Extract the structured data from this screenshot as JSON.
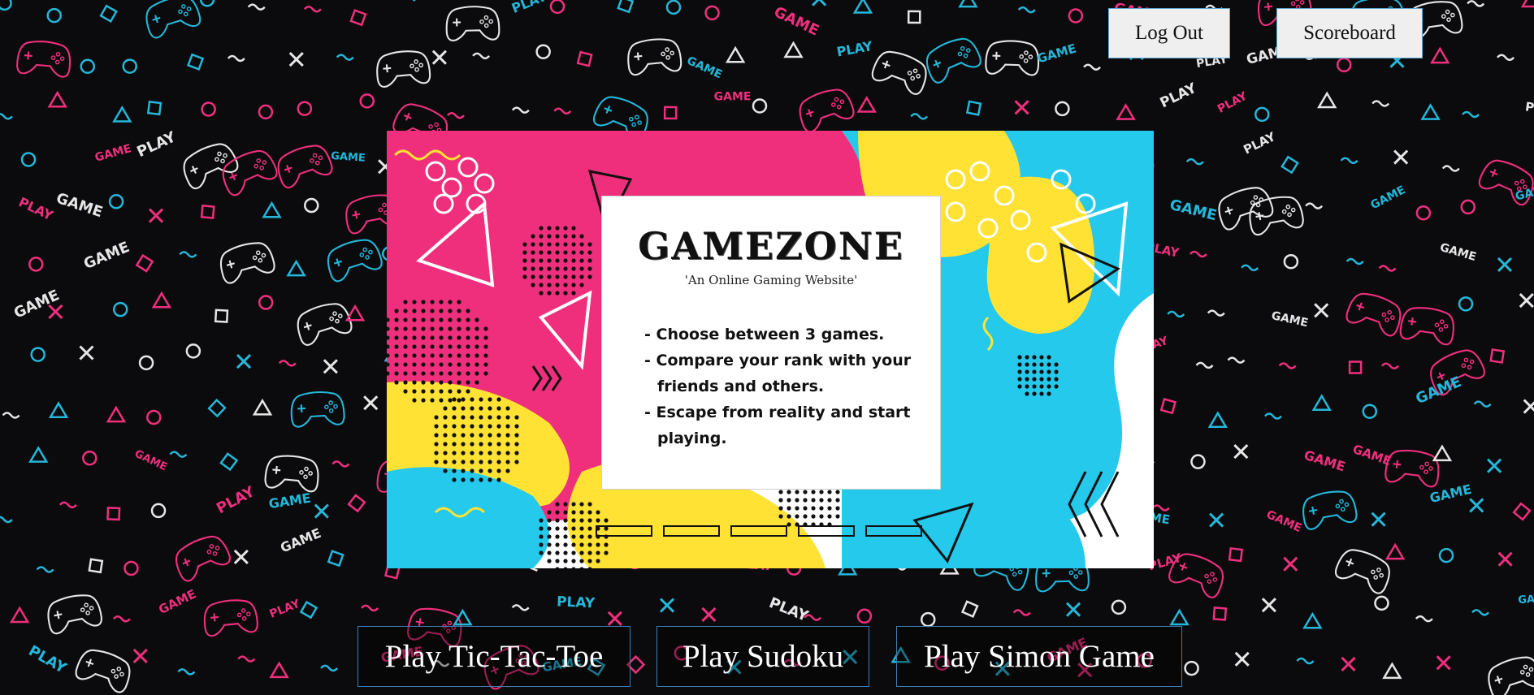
{
  "header": {
    "logout_label": "Log Out",
    "scoreboard_label": "Scoreboard"
  },
  "hero": {
    "title": "GAMEZONE",
    "subtitle": "'An Online Gaming Website'",
    "bullets": [
      "- Choose between 3 games.",
      "- Compare your rank with your friends and others.",
      "- Escape from reality and start playing."
    ]
  },
  "carousel": {
    "indicator_count": 5,
    "active_index": 0
  },
  "games": {
    "tictactoe_label": "Play Tic-Tac-Toe",
    "sudoku_label": "Play Sudoku",
    "simon_label": "Play Simon Game"
  },
  "colors": {
    "pink": "#ef2f7c",
    "cyan": "#24b7d9",
    "yellow": "#ffe234",
    "background": "#0b0b0d"
  },
  "background_pattern": {
    "words": [
      "PLAY",
      "GAME"
    ],
    "icons": [
      "gamepad-icon",
      "triangle-icon",
      "circle-icon",
      "square-icon",
      "cross-icon"
    ]
  }
}
